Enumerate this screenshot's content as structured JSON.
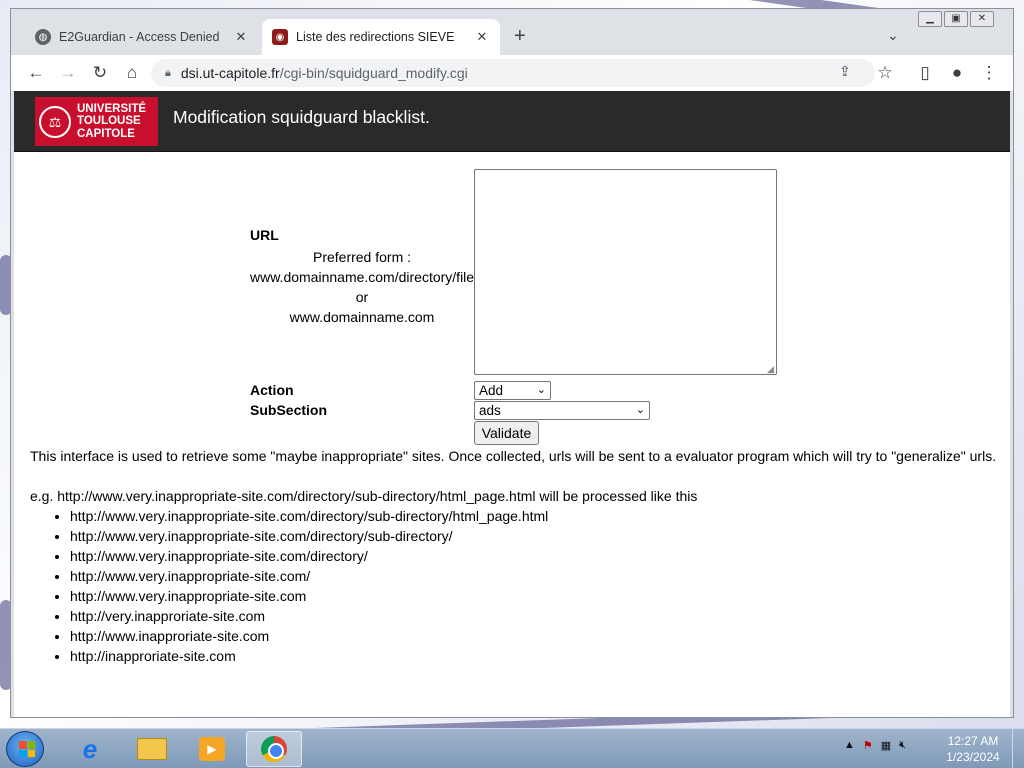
{
  "browser": {
    "tabs": [
      {
        "title": "E2Guardian - Access Denied",
        "icon": "globe-icon",
        "active": false
      },
      {
        "title": "Liste des redirections SIEVE",
        "icon": "university-favicon",
        "active": true
      }
    ],
    "address": {
      "host": "dsi.ut-capitole.fr",
      "path": "/cgi-bin/squidguard_modify.cgi"
    }
  },
  "header": {
    "logo_lines": [
      "UNIVERSITÉ",
      "TOULOUSE",
      "CAPITOLE"
    ],
    "title": "Modification squidguard blacklist."
  },
  "form": {
    "url_label": "URL",
    "preferred_lines": [
      "Preferred form :",
      "www.domainname.com/directory/file",
      "or",
      "www.domainname.com"
    ],
    "url_value": "",
    "action_label": "Action",
    "action_selected": "Add",
    "subsection_label": "SubSection",
    "subsection_selected": "ads",
    "validate_label": "Validate"
  },
  "description": {
    "text": "This interface is used to retrieve some \"maybe inappropriate\" sites. Once collected, urls will be sent to a evaluator program which will try to \"generalize\" urls.",
    "example": "e.g. http://www.very.inappropriate-site.com/directory/sub-directory/html_page.html will be processed like this",
    "items": [
      "http://www.very.inappropriate-site.com/directory/sub-directory/html_page.html",
      "http://www.very.inappropriate-site.com/directory/sub-directory/",
      "http://www.very.inappropriate-site.com/directory/",
      "http://www.very.inappropriate-site.com/",
      "http://www.very.inappropriate-site.com",
      "http://very.inapproriate-site.com",
      "http://www.inapproriate-site.com",
      "http://inapproriate-site.com"
    ]
  },
  "taskbar": {
    "time": "12:27 AM",
    "date": "1/23/2024"
  },
  "colors": {
    "header_bg": "#2a2a2a",
    "logo_red": "#c8102e",
    "taskbar": "#8aa3c0"
  }
}
